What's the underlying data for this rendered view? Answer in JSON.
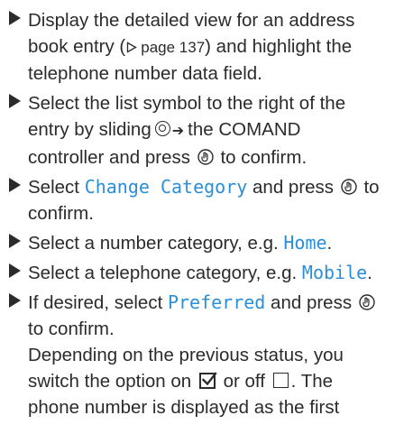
{
  "steps": [
    {
      "lines": [
        "Display the detailed view for an address",
        "book entry (",
        "page 137",
        ") and highlight the",
        "telephone number data field."
      ]
    },
    {
      "lines": [
        "Select the list symbol to the right of the",
        "entry by sliding",
        "the COMAND",
        "controller and press",
        "to confirm."
      ]
    },
    {
      "text_before": "Select",
      "highlight": "Change Category",
      "text_after": "and press",
      "text_end": "to",
      "line2": "confirm."
    },
    {
      "text_before": "Select a number category, e.g.",
      "highlight": "Home",
      "text_after": "."
    },
    {
      "text_before": "Select a telephone category, e.g.",
      "highlight": "Mobile",
      "text_after": "."
    },
    {
      "text_before": "If desired, select",
      "highlight": "Preferred",
      "text_after": "and press",
      "line2": "to confirm."
    }
  ],
  "note": {
    "line1": "Depending on the previous status, you",
    "line2_a": "switch the option on",
    "line2_b": "or off",
    "line2_c": ". The",
    "line3": "phone number is displayed as the first"
  },
  "icons": {
    "bullet": "triangle-bullet-icon",
    "page_ref": "page-reference-triangle-icon",
    "controller": "comand-controller-icon",
    "slide": "slide-right-arrow-icon",
    "press": "press-controller-icon",
    "checkbox_on": "checkbox-checked-icon",
    "checkbox_off": "checkbox-empty-icon"
  },
  "colors": {
    "text": "#2b2b2b",
    "highlight": "#2a8fd6"
  }
}
